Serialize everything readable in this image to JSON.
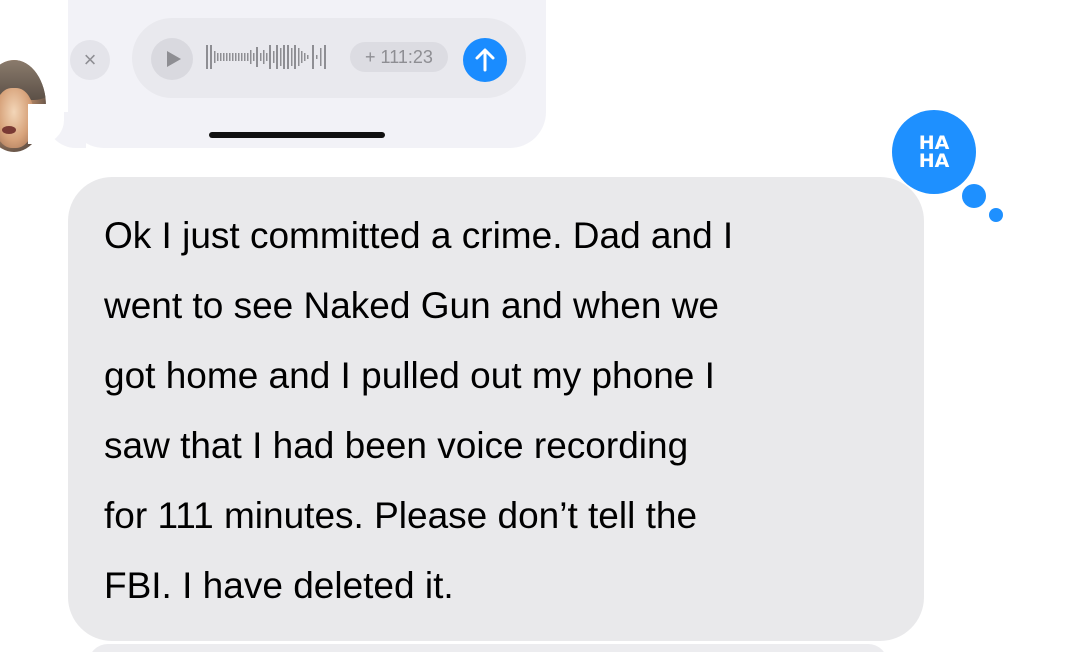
{
  "recorder": {
    "close_glyph": "×",
    "elapsed_time": "+ 111:23"
  },
  "message": {
    "text": "Ok I just committed a crime. Dad and I\nwent to see Naked Gun and when we\ngot home and I pulled out my phone I\nsaw that I had been voice recording\nfor 111 minutes. Please don’t tell the\nFBI. I have deleted it."
  },
  "tapback": {
    "line1": "HA",
    "line2": "HA",
    "icon": "haha-reaction-icon"
  },
  "colors": {
    "accent": "#1a8cff",
    "bubble_incoming": "#e9e9eb"
  }
}
